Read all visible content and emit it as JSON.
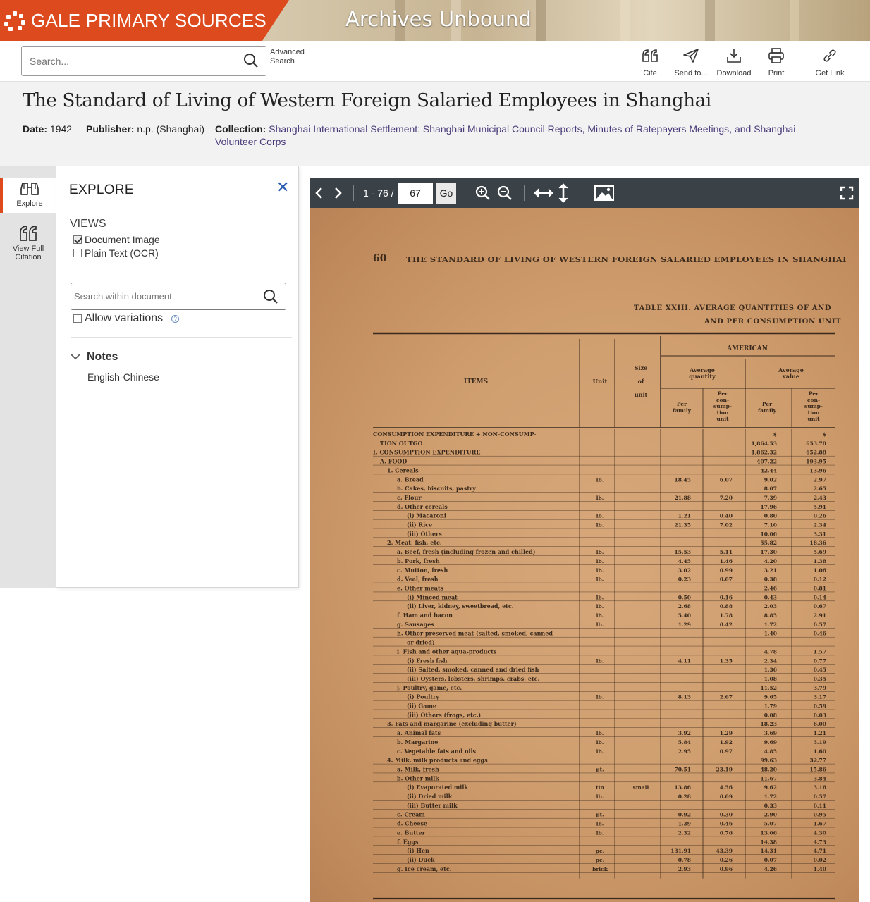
{
  "banner": {
    "brand": "GALE PRIMARY SOURCES",
    "product": "Archives Unbound"
  },
  "toolbar": {
    "search_placeholder": "Search...",
    "advanced_search": [
      "Advanced",
      "Search"
    ],
    "tools": [
      {
        "label": "Cite",
        "icon": "quote-icon"
      },
      {
        "label": "Send to...",
        "icon": "send-icon"
      },
      {
        "label": "Download",
        "icon": "download-icon"
      },
      {
        "label": "Print",
        "icon": "print-icon"
      },
      {
        "label": "Get Link",
        "icon": "link-icon"
      }
    ]
  },
  "document": {
    "title": "The Standard of Living of Western Foreign Salaried Employees in Shanghai",
    "date_label": "Date:",
    "date": "1942",
    "publisher_label": "Publisher:",
    "publisher": "n.p. (Shanghai)",
    "collection_label": "Collection:",
    "collection_line1": "Shanghai International Settlement: Shanghai Municipal Council Reports, Minutes of Ratepayers Meetings, and Shanghai",
    "collection_line2": "Volunteer Corps"
  },
  "rail": {
    "explore": "Explore",
    "citation": [
      "View Full",
      "Citation"
    ]
  },
  "explore_panel": {
    "title": "EXPLORE",
    "views_label": "VIEWS",
    "views": [
      {
        "label": "Document Image",
        "checked": true
      },
      {
        "label": "Plain Text (OCR)",
        "checked": false
      }
    ],
    "search_placeholder": "Search within document",
    "allow_variations": "Allow variations",
    "notes_label": "Notes",
    "notes_value": "English-Chinese"
  },
  "viewer": {
    "page_range": "1 - 76 /",
    "page_value": "67",
    "go": "Go"
  },
  "scan": {
    "page_number": "60",
    "running_head": "THE STANDARD OF LIVING OF WESTERN FOREIGN SALARIED EMPLOYEES IN SHANGHAI",
    "table_title_1": "TABLE XXIII. AVERAGE QUANTITIES OF AND",
    "table_title_2": "AND PER CONSUMPTION UNIT",
    "group_header": "AMERICAN",
    "col_items": "ITEMS",
    "col_unit": "Unit",
    "col_size": [
      "Size",
      "of",
      "unit"
    ],
    "col_avg_qty": [
      "Average",
      "quantity"
    ],
    "col_avg_val": [
      "Average",
      "value"
    ],
    "col_per_family": [
      "Per",
      "family"
    ],
    "col_per_unit": [
      "Per",
      "con-",
      "sump-",
      "tion",
      "unit"
    ],
    "rows": [
      {
        "item": "CONSUMPTION EXPENDITURE + NON-CONSUMP-",
        "indent": 0,
        "unit": "",
        "size": "",
        "qf": "",
        "qu": "",
        "vf": "$",
        "vu": "$"
      },
      {
        "item": "TION OUTGO",
        "indent": 1,
        "unit": "",
        "size": "",
        "qf": "",
        "qu": "",
        "vf": "1,864.53",
        "vu": "653.70"
      },
      {
        "item": "I. CONSUMPTION EXPENDITURE",
        "indent": 0,
        "unit": "",
        "size": "",
        "qf": "",
        "qu": "",
        "vf": "1,862.32",
        "vu": "652.88"
      },
      {
        "item": "A. FOOD",
        "indent": 1,
        "unit": "",
        "size": "",
        "qf": "",
        "qu": "",
        "vf": "407.22",
        "vu": "193.95"
      },
      {
        "item": "1. Cereals",
        "indent": 2,
        "unit": "",
        "size": "",
        "qf": "",
        "qu": "",
        "vf": "42.44",
        "vu": "13.96"
      },
      {
        "item": "a. Bread",
        "indent": 3,
        "unit": "lb.",
        "size": "",
        "qf": "18.45",
        "qu": "6.07",
        "vf": "9.02",
        "vu": "2.97"
      },
      {
        "item": "b. Cakes, biscuits, pastry",
        "indent": 3,
        "unit": "",
        "size": "",
        "qf": "",
        "qu": "",
        "vf": "8.07",
        "vu": "2.65"
      },
      {
        "item": "c. Flour",
        "indent": 3,
        "unit": "lb.",
        "size": "",
        "qf": "21.88",
        "qu": "7.20",
        "vf": "7.39",
        "vu": "2.43"
      },
      {
        "item": "d. Other cereals",
        "indent": 3,
        "unit": "",
        "size": "",
        "qf": "",
        "qu": "",
        "vf": "17.96",
        "vu": "5.91"
      },
      {
        "item": "(i) Macaroni",
        "indent": 4,
        "unit": "lb.",
        "size": "",
        "qf": "1.21",
        "qu": "0.40",
        "vf": "0.80",
        "vu": "0.26"
      },
      {
        "item": "(ii) Rice",
        "indent": 4,
        "unit": "lb.",
        "size": "",
        "qf": "21.35",
        "qu": "7.02",
        "vf": "7.10",
        "vu": "2.34"
      },
      {
        "item": "(iii) Others",
        "indent": 4,
        "unit": "",
        "size": "",
        "qf": "",
        "qu": "",
        "vf": "10.06",
        "vu": "3.31"
      },
      {
        "item": "2. Meat, fish, etc.",
        "indent": 2,
        "unit": "",
        "size": "",
        "qf": "",
        "qu": "",
        "vf": "55.82",
        "vu": "18.36"
      },
      {
        "item": "a. Beef, fresh (including frozen and chilled)",
        "indent": 3,
        "unit": "lb.",
        "size": "",
        "qf": "15.53",
        "qu": "5.11",
        "vf": "17.30",
        "vu": "5.69"
      },
      {
        "item": "b. Pork, fresh",
        "indent": 3,
        "unit": "lb.",
        "size": "",
        "qf": "4.45",
        "qu": "1.46",
        "vf": "4.20",
        "vu": "1.38"
      },
      {
        "item": "c. Mutton, fresh",
        "indent": 3,
        "unit": "lb.",
        "size": "",
        "qf": "3.02",
        "qu": "0.99",
        "vf": "3.21",
        "vu": "1.06"
      },
      {
        "item": "d. Veal, fresh",
        "indent": 3,
        "unit": "lb.",
        "size": "",
        "qf": "0.23",
        "qu": "0.07",
        "vf": "0.38",
        "vu": "0.12"
      },
      {
        "item": "e. Other meats",
        "indent": 3,
        "unit": "",
        "size": "",
        "qf": "",
        "qu": "",
        "vf": "2.46",
        "vu": "0.81"
      },
      {
        "item": "(i) Minced meat",
        "indent": 4,
        "unit": "lb.",
        "size": "",
        "qf": "0.50",
        "qu": "0.16",
        "vf": "0.43",
        "vu": "0.14"
      },
      {
        "item": "(ii) Liver, kidney, sweetbread, etc.",
        "indent": 4,
        "unit": "lb.",
        "size": "",
        "qf": "2.68",
        "qu": "0.88",
        "vf": "2.03",
        "vu": "0.67"
      },
      {
        "item": "f. Ham and bacon",
        "indent": 3,
        "unit": "lb.",
        "size": "",
        "qf": "5.40",
        "qu": "1.78",
        "vf": "8.85",
        "vu": "2.91"
      },
      {
        "item": "g. Sausages",
        "indent": 3,
        "unit": "lb.",
        "size": "",
        "qf": "1.29",
        "qu": "0.42",
        "vf": "1.72",
        "vu": "0.57"
      },
      {
        "item": "h. Other preserved meat (salted, smoked, canned",
        "indent": 3,
        "unit": "",
        "size": "",
        "qf": "",
        "qu": "",
        "vf": "1.40",
        "vu": "0.46"
      },
      {
        "item": "or dried)",
        "indent": 4,
        "unit": "",
        "size": "",
        "qf": "",
        "qu": "",
        "vf": "",
        "vu": ""
      },
      {
        "item": "i. Fish and other aqua-products",
        "indent": 3,
        "unit": "",
        "size": "",
        "qf": "",
        "qu": "",
        "vf": "4.78",
        "vu": "1.57"
      },
      {
        "item": "(i) Fresh fish",
        "indent": 4,
        "unit": "lb.",
        "size": "",
        "qf": "4.11",
        "qu": "1.35",
        "vf": "2.34",
        "vu": "0.77"
      },
      {
        "item": "(ii) Salted, smoked, canned and dried fish",
        "indent": 4,
        "unit": "",
        "size": "",
        "qf": "",
        "qu": "",
        "vf": "1.36",
        "vu": "0.45"
      },
      {
        "item": "(iii) Oysters, lobsters, shrimps, crabs, etc.",
        "indent": 4,
        "unit": "",
        "size": "",
        "qf": "",
        "qu": "",
        "vf": "1.08",
        "vu": "0.35"
      },
      {
        "item": "j. Poultry, game, etc.",
        "indent": 3,
        "unit": "",
        "size": "",
        "qf": "",
        "qu": "",
        "vf": "11.52",
        "vu": "3.79"
      },
      {
        "item": "(i) Poultry",
        "indent": 4,
        "unit": "lb.",
        "size": "",
        "qf": "8.13",
        "qu": "2.67",
        "vf": "9.65",
        "vu": "3.17"
      },
      {
        "item": "(ii) Game",
        "indent": 4,
        "unit": "",
        "size": "",
        "qf": "",
        "qu": "",
        "vf": "1.79",
        "vu": "0.59"
      },
      {
        "item": "(iii) Others (frogs, etc.)",
        "indent": 4,
        "unit": "",
        "size": "",
        "qf": "",
        "qu": "",
        "vf": "0.08",
        "vu": "0.03"
      },
      {
        "item": "3. Fats and margarine (excluding butter)",
        "indent": 2,
        "unit": "",
        "size": "",
        "qf": "",
        "qu": "",
        "vf": "18.23",
        "vu": "6.00"
      },
      {
        "item": "a. Animal fats",
        "indent": 3,
        "unit": "lb.",
        "size": "",
        "qf": "3.92",
        "qu": "1.29",
        "vf": "3.69",
        "vu": "1.21"
      },
      {
        "item": "b. Margarine",
        "indent": 3,
        "unit": "lb.",
        "size": "",
        "qf": "5.84",
        "qu": "1.92",
        "vf": "9.69",
        "vu": "3.19"
      },
      {
        "item": "c. Vegetable fats and oils",
        "indent": 3,
        "unit": "lb.",
        "size": "",
        "qf": "2.95",
        "qu": "0.97",
        "vf": "4.85",
        "vu": "1.60"
      },
      {
        "item": "4. Milk, milk products and eggs",
        "indent": 2,
        "unit": "",
        "size": "",
        "qf": "",
        "qu": "",
        "vf": "99.63",
        "vu": "32.77"
      },
      {
        "item": "a. Milk, fresh",
        "indent": 3,
        "unit": "pt.",
        "size": "",
        "qf": "70.51",
        "qu": "23.19",
        "vf": "48.20",
        "vu": "15.86"
      },
      {
        "item": "b. Other milk",
        "indent": 3,
        "unit": "",
        "size": "",
        "qf": "",
        "qu": "",
        "vf": "11.67",
        "vu": "3.84"
      },
      {
        "item": "(i) Evaporated milk",
        "indent": 4,
        "unit": "tin",
        "size": "small",
        "qf": "13.86",
        "qu": "4.56",
        "vf": "9.62",
        "vu": "3.16"
      },
      {
        "item": "(ii) Dried milk",
        "indent": 4,
        "unit": "lb.",
        "size": "",
        "qf": "0.28",
        "qu": "0.09",
        "vf": "1.72",
        "vu": "0.57"
      },
      {
        "item": "(iii) Butter milk",
        "indent": 4,
        "unit": "",
        "size": "",
        "qf": "",
        "qu": "",
        "vf": "0.33",
        "vu": "0.11"
      },
      {
        "item": "c. Cream",
        "indent": 3,
        "unit": "pt.",
        "size": "",
        "qf": "0.92",
        "qu": "0.30",
        "vf": "2.90",
        "vu": "0.95"
      },
      {
        "item": "d. Cheese",
        "indent": 3,
        "unit": "lb.",
        "size": "",
        "qf": "1.39",
        "qu": "0.46",
        "vf": "5.07",
        "vu": "1.67"
      },
      {
        "item": "e. Butter",
        "indent": 3,
        "unit": "lb.",
        "size": "",
        "qf": "2.32",
        "qu": "0.76",
        "vf": "13.06",
        "vu": "4.30"
      },
      {
        "item": "f. Eggs",
        "indent": 3,
        "unit": "",
        "size": "",
        "qf": "",
        "qu": "",
        "vf": "14.38",
        "vu": "4.73"
      },
      {
        "item": "(i) Hen",
        "indent": 4,
        "unit": "pc.",
        "size": "",
        "qf": "131.91",
        "qu": "43.39",
        "vf": "14.31",
        "vu": "4.71"
      },
      {
        "item": "(ii) Duck",
        "indent": 4,
        "unit": "pc.",
        "size": "",
        "qf": "0.78",
        "qu": "0.26",
        "vf": "0.07",
        "vu": "0.02"
      },
      {
        "item": "g. Ice cream, etc.",
        "indent": 3,
        "unit": "brick",
        "size": "",
        "qf": "2.93",
        "qu": "0.96",
        "vf": "4.26",
        "vu": "1.40"
      }
    ]
  }
}
